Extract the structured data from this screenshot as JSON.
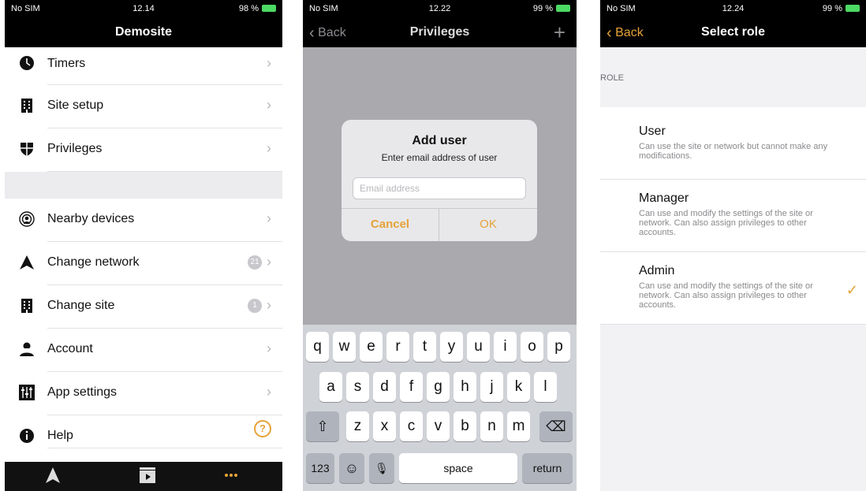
{
  "screen1": {
    "status": {
      "carrier": "No SIM",
      "time": "12.14",
      "battery": "98 %"
    },
    "title": "Demosite",
    "menu_group1": [
      {
        "label": "Timers",
        "icon": "clock-icon"
      },
      {
        "label": "Site setup",
        "icon": "building-icon"
      },
      {
        "label": "Privileges",
        "icon": "shield-icon"
      }
    ],
    "menu_group2": [
      {
        "label": "Nearby devices",
        "icon": "radar-icon"
      },
      {
        "label": "Change network",
        "icon": "network-icon",
        "badge": "21"
      },
      {
        "label": "Change site",
        "icon": "building-icon",
        "badge": "1"
      },
      {
        "label": "Account",
        "icon": "person-icon"
      },
      {
        "label": "App settings",
        "icon": "sliders-icon"
      },
      {
        "label": "Help",
        "icon": "info-icon"
      }
    ],
    "help_button": "?",
    "chevron": "›",
    "accent": "#e6a238"
  },
  "screen2": {
    "status": {
      "carrier": "No SIM",
      "time": "12.22",
      "battery": "99 %"
    },
    "back_label": "Back",
    "title": "Privileges",
    "plus": "+",
    "dialog": {
      "title": "Add user",
      "message": "Enter email address of user",
      "input_value": "",
      "placeholder": "Email address",
      "cancel": "Cancel",
      "ok": "OK"
    },
    "keyboard": {
      "row1": [
        "q",
        "w",
        "e",
        "r",
        "t",
        "y",
        "u",
        "i",
        "o",
        "p"
      ],
      "row2": [
        "a",
        "s",
        "d",
        "f",
        "g",
        "h",
        "j",
        "k",
        "l"
      ],
      "row3": [
        "z",
        "x",
        "c",
        "v",
        "b",
        "n",
        "m"
      ],
      "shift": "⇧",
      "backspace": "⌫",
      "numbers": "123",
      "emoji": "☺",
      "mic": "🎙",
      "space": "space",
      "return": "return"
    }
  },
  "screen3": {
    "status": {
      "carrier": "No SIM",
      "time": "12.24",
      "battery": "99 %"
    },
    "back_label": "Back",
    "title": "Select role",
    "section_label": "ROLE",
    "roles": [
      {
        "name": "User",
        "description": "Can use the site or network but cannot make any modifications.",
        "selected": false
      },
      {
        "name": "Manager",
        "description": "Can use and modify the settings of the site or network. Can also assign privileges to other accounts.",
        "selected": false
      },
      {
        "name": "Admin",
        "description": "Can use and modify the settings of the site or network. Can also assign privileges to other accounts.",
        "selected": true
      }
    ],
    "checkmark": "✓"
  }
}
